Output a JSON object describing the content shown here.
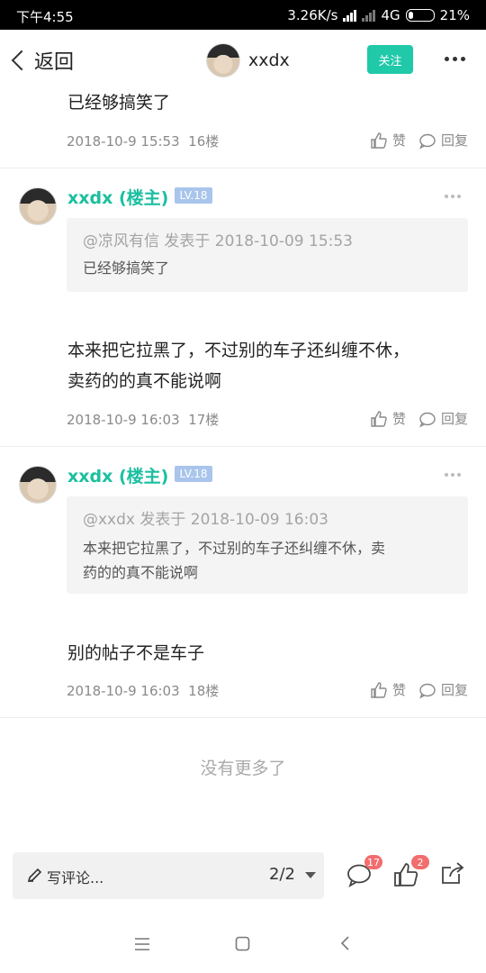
{
  "status_bar": {
    "time": "下午4:55",
    "network_speed": "3.26K/s",
    "network_type": "4G",
    "battery": "21%"
  },
  "nav": {
    "back_label": "返回",
    "username": "xxdx",
    "follow_label": "关注"
  },
  "posts": [
    {
      "body": "已经够搞笑了",
      "date": "2018-10-9 15:53",
      "floor": "16楼",
      "like_label": "赞",
      "reply_label": "回复"
    },
    {
      "author": "xxdx (楼主)",
      "level": "LV.18",
      "quote_head": "@凉风有信 发表于 2018-10-09 15:53",
      "quote_body": "已经够搞笑了",
      "body_line1": "本来把它拉黑了，不过别的车子还纠缠不休，",
      "body_line2": "卖药的的真不能说啊",
      "date": "2018-10-9 16:03",
      "floor": "17楼",
      "like_label": "赞",
      "reply_label": "回复"
    },
    {
      "author": "xxdx (楼主)",
      "level": "LV.18",
      "quote_head": "@xxdx 发表于 2018-10-09 16:03",
      "quote_body_line1": "本来把它拉黑了，不过别的车子还纠缠不休，卖",
      "quote_body_line2": "药的的真不能说啊",
      "body": "别的帖子不是车子",
      "date": "2018-10-9 16:03",
      "floor": "18楼",
      "like_label": "赞",
      "reply_label": "回复"
    }
  ],
  "no_more": "没有更多了",
  "bottom_bar": {
    "comment_placeholder": "写评论...",
    "page": "2/2",
    "comment_count": "17",
    "like_count": "2"
  },
  "icons": {
    "back": "chevron-left-icon",
    "more": "more-dots-icon",
    "like": "thumbs-up-icon",
    "reply": "chat-bubble-icon",
    "pen": "pen-icon",
    "share": "share-icon"
  },
  "colors": {
    "accent": "#1bbfa0",
    "follow_bg": "#20c9a8",
    "badge": "#f26d6d",
    "level_badge": "#a9c5ec"
  }
}
